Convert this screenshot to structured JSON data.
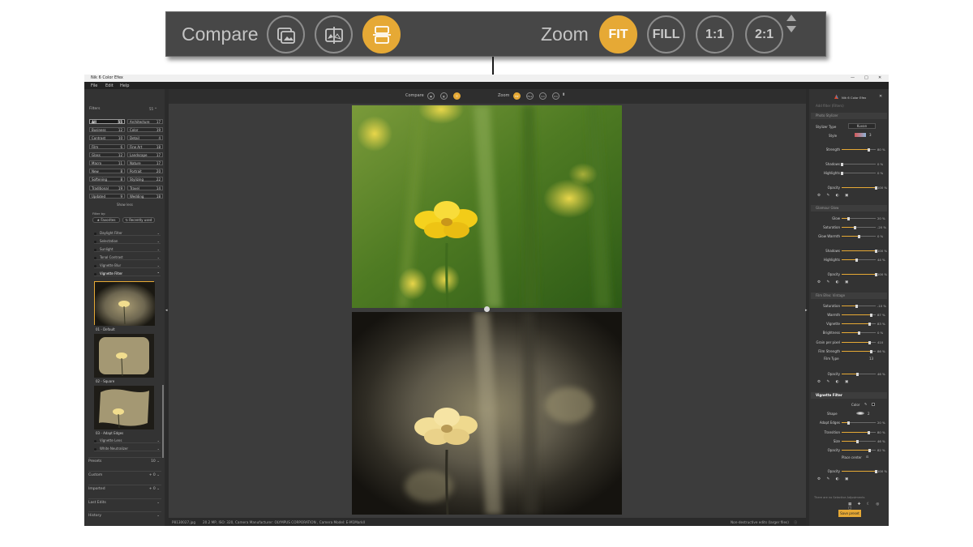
{
  "callout": {
    "compare_label": "Compare",
    "zoom_label": "Zoom",
    "zoom_buttons": [
      "FIT",
      "FILL",
      "1:1",
      "2:1"
    ]
  },
  "window": {
    "title": "Nik 6 Color Efex",
    "menu": [
      "File",
      "Edit",
      "Help"
    ]
  },
  "left": {
    "filters_heading": "Filters",
    "categories": [
      {
        "name": "All",
        "count": "55",
        "selected": true
      },
      {
        "name": "Architecture",
        "count": "17"
      },
      {
        "name": "Business",
        "count": "12"
      },
      {
        "name": "Color",
        "count": "19"
      },
      {
        "name": "Contrast",
        "count": "10"
      },
      {
        "name": "Detail",
        "count": "4"
      },
      {
        "name": "Film",
        "count": "6"
      },
      {
        "name": "Fine Art",
        "count": "18"
      },
      {
        "name": "Glass",
        "count": "12"
      },
      {
        "name": "Landscape",
        "count": "17"
      },
      {
        "name": "Macro",
        "count": "11"
      },
      {
        "name": "Nature",
        "count": "17"
      },
      {
        "name": "New",
        "count": "8"
      },
      {
        "name": "Portrait",
        "count": "20"
      },
      {
        "name": "Softening",
        "count": "8"
      },
      {
        "name": "Stylizing",
        "count": "22"
      },
      {
        "name": "Traditional",
        "count": "19"
      },
      {
        "name": "Travel",
        "count": "14"
      },
      {
        "name": "Updated",
        "count": "9"
      },
      {
        "name": "Wedding",
        "count": "18"
      }
    ],
    "show_less": "Show less",
    "filter_by": "Filter by:",
    "favorites": "Favorites",
    "recently_used": "Recently used",
    "filter_items": [
      "Daylight Filter",
      "Selectation",
      "Sunlight",
      "Tonal Contrast",
      "Vignette Blur",
      "Vignette Filter"
    ],
    "thumbs": [
      "01 - Default",
      "02 - Square",
      "03 - Adapt Edges"
    ],
    "filter_items_after": [
      "Vignette Lens",
      "White Neutralizer"
    ],
    "sections": [
      {
        "label": "Presets",
        "count": "10"
      },
      {
        "label": "Custom",
        "count": "0"
      },
      {
        "label": "Imported",
        "count": "0"
      },
      {
        "label": "Last Edits",
        "count": ""
      },
      {
        "label": "History",
        "count": ""
      }
    ]
  },
  "center": {
    "compare_label": "Compare",
    "zoom_label": "Zoom",
    "zoom_buttons": [
      "FIT",
      "FILL",
      "1:1",
      "2:1"
    ],
    "status_file": "P8130027.jpg",
    "status_meta": "20.2 MP, ISO: 320, Camera Manufacturer: OLYMPUS CORPORATION , Camera Model: E-M1MarkII",
    "status_edits": "Non-destructive edits (larger files)"
  },
  "right": {
    "header_title": "Nik 6 Color Efex",
    "add_filter": "Add filter (Filters)",
    "photo_stylizer": "Photo Stylizer",
    "stylizer_type_label": "Stylizer Type",
    "stylizer_type_value": "Kuvan",
    "style_label": "Style",
    "style_value": "3",
    "ps_strength": {
      "label": "Strength",
      "value": "80 %"
    },
    "ps_shadows": {
      "label": "Shadows",
      "value": "0 %"
    },
    "ps_highlights": {
      "label": "Highlights",
      "value": "0 %"
    },
    "ps_opacity": {
      "label": "Opacity",
      "value": "100 %"
    },
    "glamour_glow": "Glamour Glow",
    "gg_glow": {
      "label": "Glow",
      "value": "20 %"
    },
    "gg_saturation": {
      "label": "Saturation",
      "value": "-20 %"
    },
    "gg_glowwarmth": {
      "label": "Glow Warmth",
      "value": "0 %"
    },
    "gg_shadows": {
      "label": "Shadows",
      "value": "100 %"
    },
    "gg_highlights": {
      "label": "Highlights",
      "value": "44 %"
    },
    "gg_opacity": {
      "label": "Opacity",
      "value": "100 %"
    },
    "film_efex": "Film Efex: Vintage",
    "fe_saturation": {
      "label": "Saturation",
      "value": "-10 %"
    },
    "fe_warmth": {
      "label": "Warmth",
      "value": "87 %"
    },
    "fe_vignette": {
      "label": "Vignette",
      "value": "83 %"
    },
    "fe_brightness": {
      "label": "Brightness",
      "value": "0 %"
    },
    "fe_grain": {
      "label": "Grain per pixel",
      "value": "410"
    },
    "fe_filmstrength": {
      "label": "Film Strength",
      "value": "86 %"
    },
    "fe_filmtype_label": "Film Type",
    "fe_filmtype_value": "13",
    "fe_opacity": {
      "label": "Opacity",
      "value": "46 %"
    },
    "vignette_filter": "Vignette Filter",
    "vf_color": "Color",
    "vf_shape_label": "Shape",
    "vf_shape_value": "2",
    "vf_adaptedges": {
      "label": "Adapt Edges",
      "value": "20 %"
    },
    "vf_transition": {
      "label": "Transition",
      "value": "80 %"
    },
    "vf_size": {
      "label": "Size",
      "value": "46 %"
    },
    "vf_opacity": {
      "label": "Opacity",
      "value": "82 %"
    },
    "vf_place_center": "Place center",
    "global_opacity": {
      "label": "Opacity",
      "value": "100 %"
    },
    "no_selective": "There are no Selective Adjustments",
    "save_preset": "Save preset"
  },
  "colors": {
    "accent": "#e6a935",
    "panel": "#333333",
    "canvas": "#3c3c3c"
  },
  "slider_levels": {
    "ps_strength": 0.8,
    "ps_shadows": 0.0,
    "ps_highlights": 0.0,
    "ps_opacity": 1.0,
    "gg_glow": 0.2,
    "gg_saturation": 0.4,
    "gg_glowwarmth": 0.5,
    "gg_shadows": 1.0,
    "gg_highlights": 0.44,
    "gg_opacity": 1.0,
    "fe_saturation": 0.45,
    "fe_warmth": 0.87,
    "fe_vignette": 0.83,
    "fe_brightness": 0.5,
    "fe_grain": 0.82,
    "fe_filmstrength": 0.86,
    "fe_opacity": 0.46,
    "vf_adaptedges": 0.2,
    "vf_transition": 0.8,
    "vf_size": 0.46,
    "vf_opacity": 0.82,
    "global_opacity": 1.0
  }
}
